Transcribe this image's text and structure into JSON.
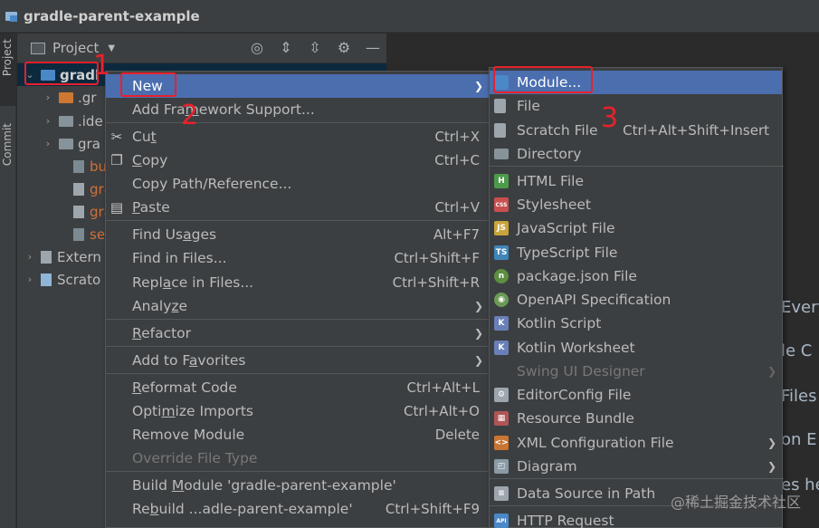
{
  "window": {
    "title": "gradle-parent-example"
  },
  "left_strip": {
    "project_tab": "Project",
    "commit_tab": "Commit"
  },
  "project_panel": {
    "title": "Project",
    "tree": [
      {
        "label": "gradl",
        "type": "module"
      },
      {
        "label": ".gr",
        "type": "folder-orange"
      },
      {
        "label": ".ide",
        "type": "folder"
      },
      {
        "label": "gra",
        "type": "folder"
      },
      {
        "label": "bui",
        "type": "gradle-file"
      },
      {
        "label": "gra",
        "type": "file"
      },
      {
        "label": "gra",
        "type": "file"
      },
      {
        "label": "set",
        "type": "gradle-file"
      },
      {
        "label": "Extern",
        "type": "libraries"
      },
      {
        "label": "Scrato",
        "type": "scratches"
      }
    ]
  },
  "editor": {
    "lines": [
      "Every",
      "le  C",
      "Files",
      "on E",
      "es he"
    ]
  },
  "context_menu": {
    "items": [
      {
        "label": "New",
        "shortcut": "",
        "submenu": true
      },
      {
        "label": "Add Framework Support...",
        "shortcut": ""
      },
      {
        "label": "Cut",
        "shortcut": "Ctrl+X",
        "icon": "scissors"
      },
      {
        "label": "Copy",
        "shortcut": "Ctrl+C",
        "icon": "copy"
      },
      {
        "label": "Copy Path/Reference...",
        "shortcut": ""
      },
      {
        "label": "Paste",
        "shortcut": "Ctrl+V",
        "icon": "clipboard"
      },
      {
        "label": "Find Usages",
        "shortcut": "Alt+F7"
      },
      {
        "label": "Find in Files...",
        "shortcut": "Ctrl+Shift+F"
      },
      {
        "label": "Replace in Files...",
        "shortcut": "Ctrl+Shift+R"
      },
      {
        "label": "Analyze",
        "shortcut": "",
        "submenu": true
      },
      {
        "label": "Refactor",
        "shortcut": "",
        "submenu": true
      },
      {
        "label": "Add to Favorites",
        "shortcut": "",
        "submenu": true
      },
      {
        "label": "Reformat Code",
        "shortcut": "Ctrl+Alt+L"
      },
      {
        "label": "Optimize Imports",
        "shortcut": "Ctrl+Alt+O"
      },
      {
        "label": "Remove Module",
        "shortcut": "Delete"
      },
      {
        "label": "Override File Type",
        "shortcut": "",
        "disabled": true
      },
      {
        "label": "Build Module 'gradle-parent-example'",
        "shortcut": ""
      },
      {
        "label": "Rebuild ...adle-parent-example'",
        "shortcut": "Ctrl+Shift+F9"
      }
    ]
  },
  "new_submenu": {
    "items": [
      {
        "label": "Module...",
        "shortcut": "",
        "icon": "module",
        "color": "#4a88c7"
      },
      {
        "label": "File",
        "shortcut": "",
        "icon": "file",
        "color": "#9da6ad"
      },
      {
        "label": "Scratch File",
        "shortcut": "Ctrl+Alt+Shift+Insert",
        "icon": "scratch",
        "color": "#9da6ad"
      },
      {
        "label": "Directory",
        "shortcut": "",
        "icon": "folder",
        "color": "#87939a"
      },
      {
        "label": "HTML File",
        "shortcut": "",
        "icon": "H",
        "color": "#4e9a4b"
      },
      {
        "label": "Stylesheet",
        "shortcut": "",
        "icon": "CSS",
        "color": "#c94f4f"
      },
      {
        "label": "JavaScript File",
        "shortcut": "",
        "icon": "JS",
        "color": "#c9a43b"
      },
      {
        "label": "TypeScript File",
        "shortcut": "",
        "icon": "TS",
        "color": "#3f86b8"
      },
      {
        "label": "package.json File",
        "shortcut": "",
        "icon": "npm",
        "color": "#5c8f3f"
      },
      {
        "label": "OpenAPI Specification",
        "shortcut": "",
        "icon": "api",
        "color": "#6a9a55"
      },
      {
        "label": "Kotlin Script",
        "shortcut": "",
        "icon": "kts",
        "color": "#6a7fb8"
      },
      {
        "label": "Kotlin Worksheet",
        "shortcut": "",
        "icon": "ktw",
        "color": "#6a7fb8"
      },
      {
        "label": "Swing UI Designer",
        "shortcut": "",
        "disabled": true,
        "submenu": true
      },
      {
        "label": "EditorConfig File",
        "shortcut": "",
        "icon": "gear",
        "color": "#9da6ad"
      },
      {
        "label": "Resource Bundle",
        "shortcut": "",
        "icon": "bundle",
        "color": "#b05555"
      },
      {
        "label": "XML Configuration File",
        "shortcut": "",
        "icon": "xml",
        "color": "#c87533",
        "submenu": true
      },
      {
        "label": "Diagram",
        "shortcut": "",
        "icon": "diagram",
        "color": "#8a9aa6",
        "submenu": true
      },
      {
        "label": "Data Source in Path",
        "shortcut": "",
        "icon": "db",
        "color": "#9da6ad"
      },
      {
        "label": "HTTP Request",
        "shortcut": "",
        "icon": "API",
        "color": "#4a88c7"
      }
    ]
  },
  "annotations": [
    "1",
    "2",
    "3"
  ],
  "watermark": "@稀土掘金技术社区"
}
